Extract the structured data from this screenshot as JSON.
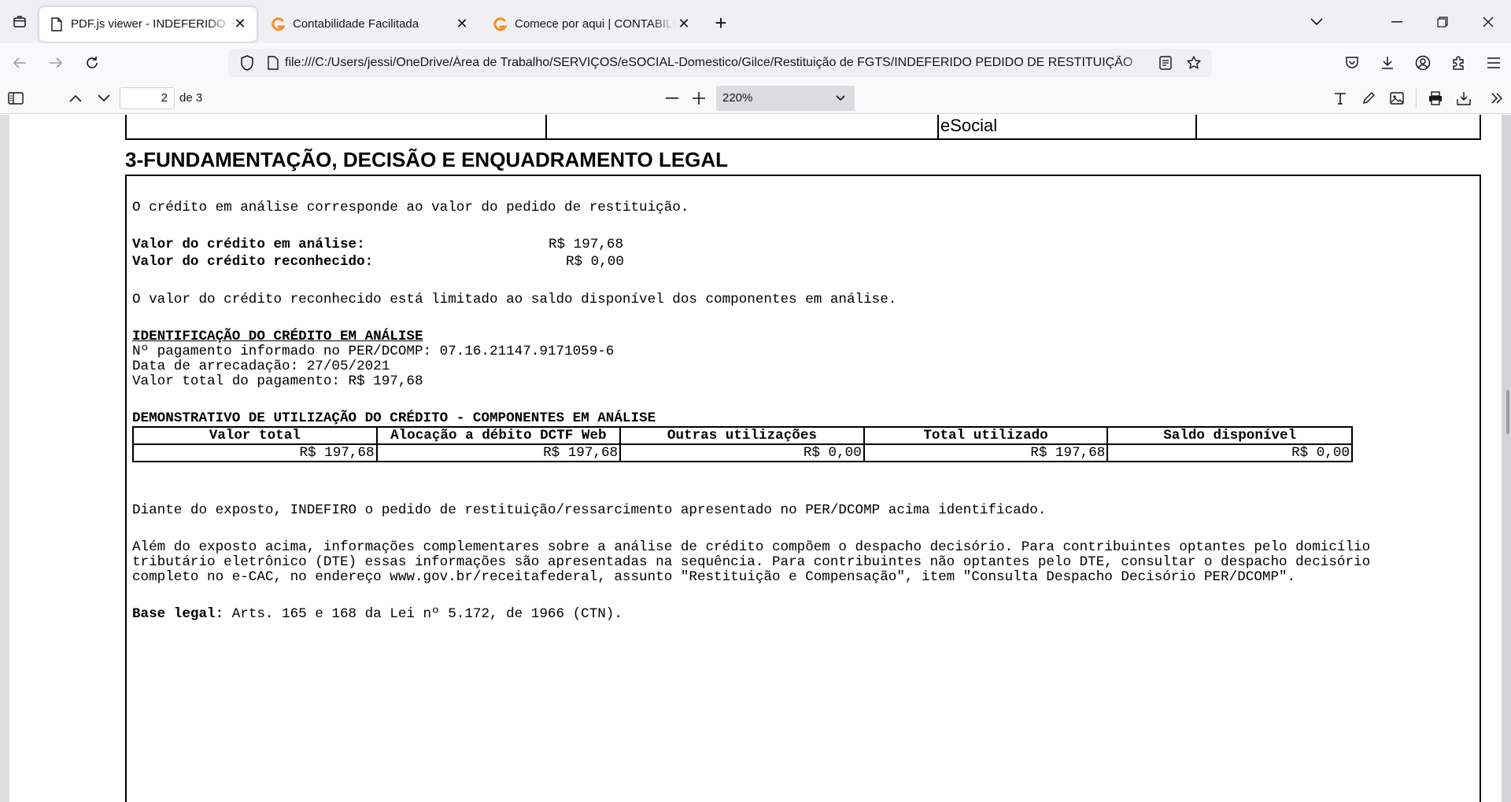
{
  "browser": {
    "tabs": [
      {
        "title": "PDF.js viewer - INDEFERIDO PEDIDO DE RESTITUIÇÃO",
        "active": true,
        "favicon": "pdf-file-icon"
      },
      {
        "title": "Contabilidade Facilitada",
        "active": false,
        "favicon": "contabilidade-logo-icon"
      },
      {
        "title": "Comece por aqui | CONTABILIDADE",
        "active": false,
        "favicon": "contabilidade-logo-icon"
      }
    ],
    "url": "file:///C:/Users/jessi/OneDrive/Área de Trabalho/SERVIÇOS/eSOCIAL-Domestico/Gilce/Restituição de FGTS/INDEFERIDO PEDIDO DE RESTITUIÇÃO",
    "accent_color": "#0060df",
    "favicon_color": "#f28c28"
  },
  "pdf_toolbar": {
    "page_number": "2",
    "page_of": "de 3",
    "zoom": "220%"
  },
  "document": {
    "top_table_cell": "eSocial",
    "section_title": "3-FUNDAMENTAÇÃO, DECISÃO E ENQUADRAMENTO LEGAL",
    "intro": "O crédito em análise corresponde ao valor do pedido de restituição.",
    "credit_analysis_label": "Valor do crédito em análise:",
    "credit_analysis_value": "R$ 197,68",
    "credit_recognized_label": "Valor do crédito reconhecido:",
    "credit_recognized_value": "R$ 0,00",
    "limited_note": "O valor do crédito reconhecido está limitado ao saldo disponível dos componentes em análise.",
    "identification_heading": "IDENTIFICAÇÃO DO CRÉDITO EM ANÁLISE",
    "payment_number": "Nº pagamento informado no PER/DCOMP: 07.16.21147.9171059-6",
    "collection_date": "Data de arrecadação: 27/05/2021",
    "payment_total": "Valor total do pagamento: R$ 197,68",
    "statement_heading": "DEMONSTRATIVO DE UTILIZAÇÃO DO CRÉDITO - COMPONENTES EM ANÁLISE",
    "table": {
      "headers": [
        "Valor total",
        "Alocação a débito DCTF Web",
        "Outras utilizações",
        "Total utilizado",
        "Saldo disponível"
      ],
      "row": [
        "R$ 197,68",
        "R$ 197,68",
        "R$ 0,00",
        "R$ 197,68",
        "R$ 0,00"
      ]
    },
    "decision": "Diante do exposto, INDEFIRO o pedido de restituição/ressarcimento apresentado no PER/DCOMP acima identificado.",
    "complement_line1": "Além do exposto acima, informações complementares sobre a análise de crédito compõem o despacho decisório. Para contribuintes optantes pelo domicílio",
    "complement_line2": "tributário eletrônico (DTE) essas informações são apresentadas na sequência. Para contribuintes não optantes pelo DTE, consultar o despacho decisório",
    "complement_line3": "completo no e-CAC, no endereço www.gov.br/receitafederal, assunto \"Restituição e Compensação\", item \"Consulta Despacho Decisório PER/DCOMP\".",
    "legal_base_label": "Base legal:",
    "legal_base_text": " Arts. 165 e 168 da Lei nº 5.172, de 1966 (CTN)."
  }
}
